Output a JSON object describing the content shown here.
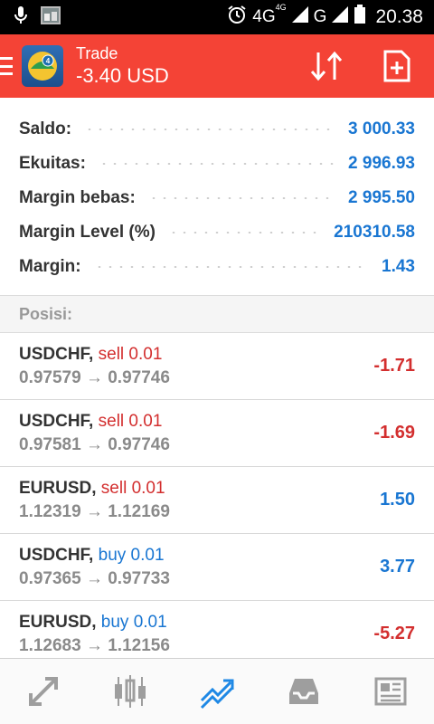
{
  "status_bar": {
    "network": "4G",
    "network_sup": "4G",
    "network2": "G",
    "time": "20.38",
    "icons": [
      "mic-icon",
      "photo-icon",
      "alarm-icon",
      "signal-icon",
      "battery-icon"
    ]
  },
  "appbar": {
    "title": "Trade",
    "subtitle": "-3.40 USD",
    "background": "#f44336",
    "icons": [
      "menu-icon",
      "sort-icon",
      "new-order-icon"
    ]
  },
  "summary": [
    {
      "label": "Saldo:",
      "value": "3 000.33"
    },
    {
      "label": "Ekuitas:",
      "value": "2 996.93"
    },
    {
      "label": "Margin bebas:",
      "value": "2 995.50"
    },
    {
      "label": "Margin Level (%)",
      "value": "210310.58"
    },
    {
      "label": "Margin:",
      "value": "1.43"
    }
  ],
  "section_title": "Posisi:",
  "positions": [
    {
      "symbol": "USDCHF,",
      "side": "sell 0.01",
      "type": "sell",
      "prices": "0.97579 → 0.97746",
      "profit": "-1.71"
    },
    {
      "symbol": "USDCHF,",
      "side": "sell 0.01",
      "type": "sell",
      "prices": "0.97581 → 0.97746",
      "profit": "-1.69"
    },
    {
      "symbol": "EURUSD,",
      "side": "sell 0.01",
      "type": "sell",
      "prices": "1.12319 → 1.12169",
      "profit": "1.50"
    },
    {
      "symbol": "USDCHF,",
      "side": "buy 0.01",
      "type": "buy",
      "prices": "0.97365 → 0.97733",
      "profit": "3.77"
    },
    {
      "symbol": "EURUSD,",
      "side": "buy 0.01",
      "type": "buy",
      "prices": "1.12683 → 1.12156",
      "profit": "-5.27"
    }
  ],
  "bottom_nav": [
    "quotes-icon",
    "chart-icon",
    "trade-icon",
    "history-icon",
    "news-icon"
  ],
  "colors": {
    "accent": "#f44336",
    "blue": "#1976d2",
    "red": "#d32f2f",
    "active_nav": "#1e88e5",
    "inactive_nav": "#9e9e9e"
  }
}
